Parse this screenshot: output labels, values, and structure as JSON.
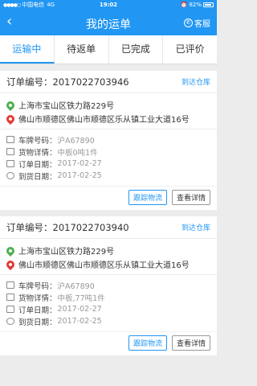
{
  "status": {
    "carrier": "中国电信",
    "network": "4G",
    "time": "19:02",
    "battery": "82%"
  },
  "nav": {
    "title": "我的运单",
    "service_label": "客服"
  },
  "tabs": [
    {
      "label": "运输中"
    },
    {
      "label": "待返单"
    },
    {
      "label": "已完成"
    },
    {
      "label": "已评价"
    }
  ],
  "orders": [
    {
      "order_no": "订单编号：2017022703946",
      "arrive_label": "到达仓库",
      "from": "上海市宝山区铁力路229号",
      "to": "佛山市顺德区佛山市顺德区乐从镇工业大道16号",
      "plate_label": "车牌号码：",
      "plate": "沪A67890",
      "goods_label": "货物详情：",
      "goods": "中板0吨1件",
      "order_date_label": "订单日期：",
      "order_date": "2017-02-27",
      "arrival_label": "到货日期：",
      "arrival": "2017-02-25",
      "track_label": "跟踪物流",
      "detail_label": "查看详情"
    },
    {
      "order_no": "订单编号：2017022703940",
      "arrive_label": "到达仓库",
      "from": "上海市宝山区铁力路229号",
      "to": "佛山市顺德区佛山市顺德区乐从镇工业大道16号",
      "plate_label": "车牌号码：",
      "plate": "沪A67890",
      "goods_label": "货物详情：",
      "goods": "中板,77吨1件",
      "order_date_label": "订单日期：",
      "order_date": "2017-02-27",
      "arrival_label": "到货日期：",
      "arrival": "2017-02-25",
      "track_label": "跟踪物流",
      "detail_label": "查看详情"
    }
  ]
}
